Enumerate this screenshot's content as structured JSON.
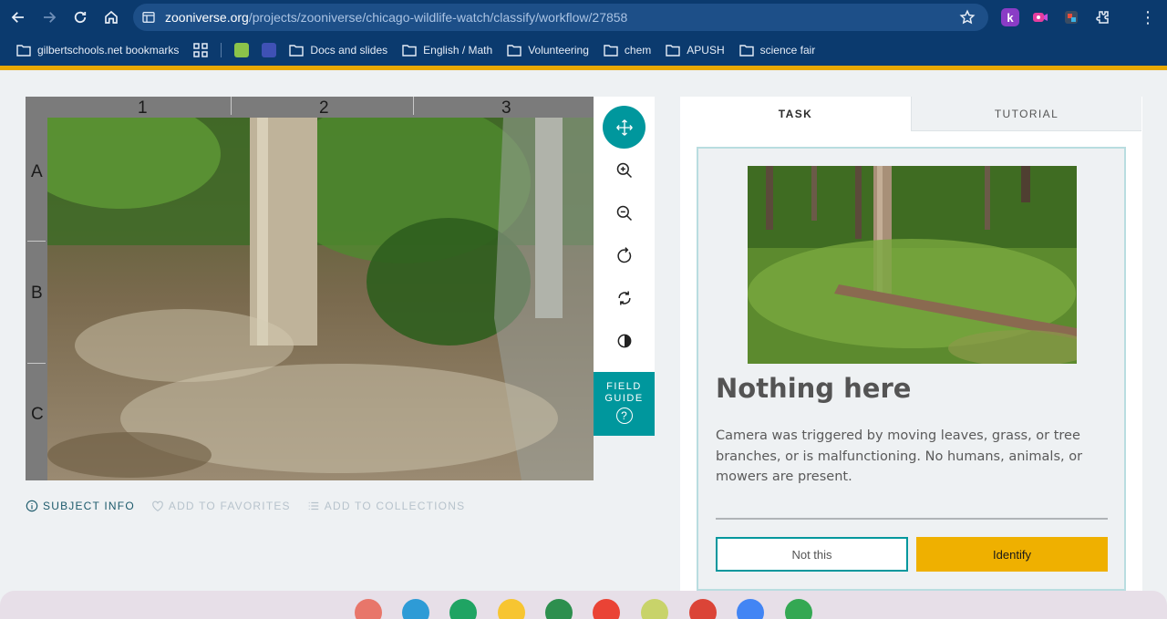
{
  "browser": {
    "url_host": "zooniverse.org",
    "url_path": "/projects/zooniverse/chicago-wildlife-watch/classify/workflow/27858",
    "bookmarks": [
      {
        "label": "gilbertschools.net bookmarks"
      },
      {
        "label": "Docs and slides"
      },
      {
        "label": "English / Math"
      },
      {
        "label": "Volunteering"
      },
      {
        "label": "chem"
      },
      {
        "label": "APUSH"
      },
      {
        "label": "science fair"
      }
    ],
    "extension_k": "k",
    "accent_color": "#e9a800",
    "chrome_color": "#0b3a6e"
  },
  "subject": {
    "columns": [
      "1",
      "2",
      "3"
    ],
    "rows": [
      "A",
      "B",
      "C"
    ]
  },
  "toolbar": {
    "tools": [
      "move-icon",
      "zoom-in-icon",
      "zoom-out-icon",
      "rotate-icon",
      "reset-icon",
      "invert-icon"
    ],
    "field_guide_line1": "FIELD",
    "field_guide_line2": "GUIDE",
    "field_guide_icon": "?",
    "accent": "#00979d"
  },
  "meta_links": {
    "subject_info": "SUBJECT INFO",
    "add_to_favorites": "ADD TO FAVORITES",
    "add_to_collections": "ADD TO COLLECTIONS"
  },
  "task_panel": {
    "tabs": [
      {
        "label": "TASK"
      },
      {
        "label": "TUTORIAL"
      }
    ],
    "title": "Nothing here",
    "description": "Camera was triggered by moving leaves, grass, or tree branches, or is malfunctioning. No humans, animals, or mowers are present.",
    "not_this_label": "Not this",
    "identify_label": "Identify",
    "identify_color": "#efb000"
  }
}
